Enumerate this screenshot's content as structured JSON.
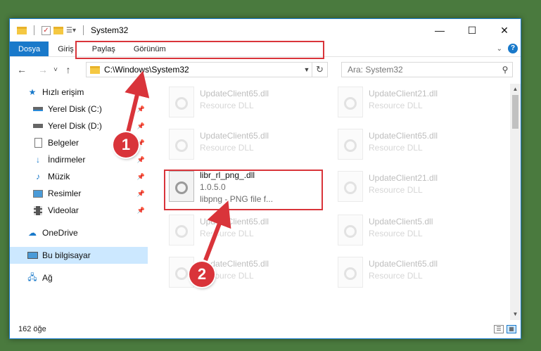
{
  "window": {
    "title": "System32",
    "controls": {
      "minimize": "—",
      "maximize": "☐",
      "close": "✕"
    }
  },
  "ribbon": {
    "tabs": [
      {
        "label": "Dosya",
        "active": true
      },
      {
        "label": "Giriş"
      },
      {
        "label": "Paylaş"
      },
      {
        "label": "Görünüm"
      }
    ],
    "help": "?"
  },
  "navigation": {
    "back": "←",
    "forward": "→",
    "recent": "˅",
    "up": "↑",
    "address": "C:\\Windows\\System32",
    "refresh": "↻",
    "search_placeholder": "Ara: System32"
  },
  "sidebar": {
    "items": [
      {
        "label": "Hızlı erişim",
        "icon": "star-icon"
      },
      {
        "label": "Yerel Disk (C:)",
        "icon": "drive-icon",
        "pinned": true
      },
      {
        "label": "Yerel Disk (D:)",
        "icon": "drive-icon",
        "pinned": true
      },
      {
        "label": "Belgeler",
        "icon": "documents-icon",
        "pinned": true
      },
      {
        "label": "İndirmeler",
        "icon": "downloads-icon",
        "pinned": true
      },
      {
        "label": "Müzik",
        "icon": "music-icon",
        "pinned": true
      },
      {
        "label": "Resimler",
        "icon": "pictures-icon",
        "pinned": true
      },
      {
        "label": "Videolar",
        "icon": "videos-icon",
        "pinned": true
      },
      {
        "label": "OneDrive",
        "icon": "cloud-icon"
      },
      {
        "label": "Bu bilgisayar",
        "icon": "computer-icon",
        "selected": true
      },
      {
        "label": "Ağ",
        "icon": "network-icon"
      }
    ]
  },
  "files": [
    {
      "name": "UpdateClient65.dll",
      "sub1": "Resource DLL",
      "sub2": ""
    },
    {
      "name": "UpdateClient21.dll",
      "sub1": "Resource DLL",
      "sub2": ""
    },
    {
      "name": "UpdateClient65.dll",
      "sub1": "Resource DLL",
      "sub2": ""
    },
    {
      "name": "UpdateClient65.dll",
      "sub1": "Resource DLL",
      "sub2": ""
    },
    {
      "name": "libr_rl_png_.dll",
      "sub1": "1.0.5.0",
      "sub2": "libpng - PNG file f..."
    },
    {
      "name": "UpdateClient21.dll",
      "sub1": "Resource DLL",
      "sub2": ""
    },
    {
      "name": "UpdateClient65.dll",
      "sub1": "Resource DLL",
      "sub2": ""
    },
    {
      "name": "UpdateClient5.dll",
      "sub1": "Resource DLL",
      "sub2": ""
    },
    {
      "name": "UpdateClient65.dll",
      "sub1": "Resource DLL",
      "sub2": ""
    },
    {
      "name": "UpdateClient65.dll",
      "sub1": "Resource DLL",
      "sub2": ""
    }
  ],
  "status": {
    "count": "162 öğe"
  },
  "callouts": {
    "one": "1",
    "two": "2"
  },
  "colors": {
    "accent": "#1979ca",
    "highlight": "#d9343a",
    "selected_bg": "#cce8ff",
    "desktop": "#4a7a3e"
  }
}
